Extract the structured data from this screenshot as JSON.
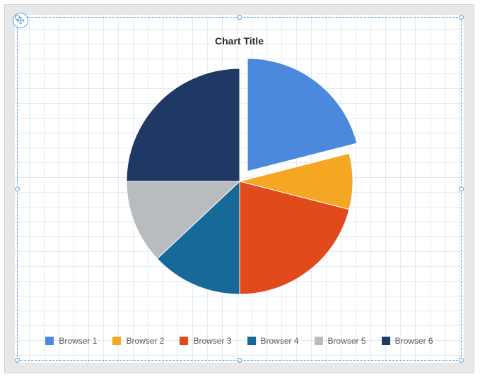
{
  "chart_data": {
    "type": "pie",
    "title": "Chart Title",
    "series": [
      {
        "name": "Browser 1",
        "value": 21,
        "color": "#4a89dc",
        "exploded": true
      },
      {
        "name": "Browser 2",
        "value": 8,
        "color": "#f5a623",
        "exploded": false
      },
      {
        "name": "Browser 3",
        "value": 21,
        "color": "#e14a1b",
        "exploded": false
      },
      {
        "name": "Browser 4",
        "value": 13,
        "color": "#166a9a",
        "exploded": false
      },
      {
        "name": "Browser 5",
        "value": 12,
        "color": "#b9bcbe",
        "exploded": false
      },
      {
        "name": "Browser 6",
        "value": 25,
        "color": "#1f3864",
        "exploded": false
      }
    ],
    "explode_offset": 18
  },
  "ui": {
    "move_handle_name": "move-handle"
  }
}
